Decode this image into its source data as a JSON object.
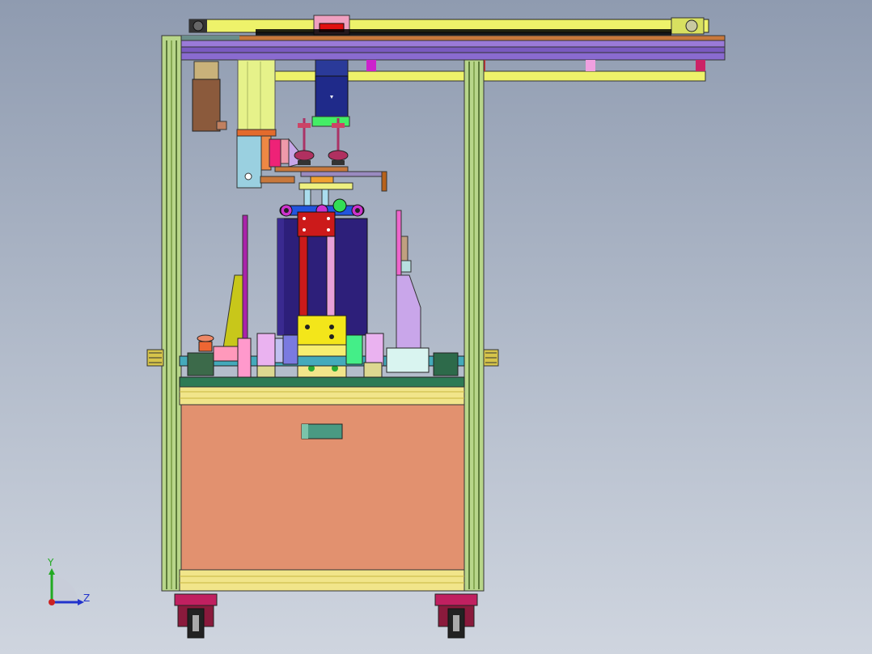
{
  "viewport": {
    "background_top": "#8f9bb0",
    "background_bottom": "#cfd5df"
  },
  "model": {
    "name": "",
    "colors": {
      "frame_green": "#b8d68a",
      "frame_green_dark": "#5c7a3a",
      "rail_yellow": "#eef26a",
      "top_beam_purple": "#8a6bd0",
      "top_beam_orange": "#c8783c",
      "cabinet_salmon": "#e2916f",
      "base_plate_yellow": "#f1e58a",
      "motor_blue": "#1f2a8a",
      "block_navy": "#2d1f7a",
      "red": "#cc1a1a",
      "magenta": "#cc2288",
      "teal": "#3fa08a",
      "caster_maroon": "#8a1a3c"
    }
  },
  "triad": {
    "y_label": "Y",
    "z_label": "Z",
    "y_color": "#22aa22",
    "z_color": "#2233cc",
    "origin_color": "#cc2222",
    "icon": "coordinate-triad-icon"
  }
}
